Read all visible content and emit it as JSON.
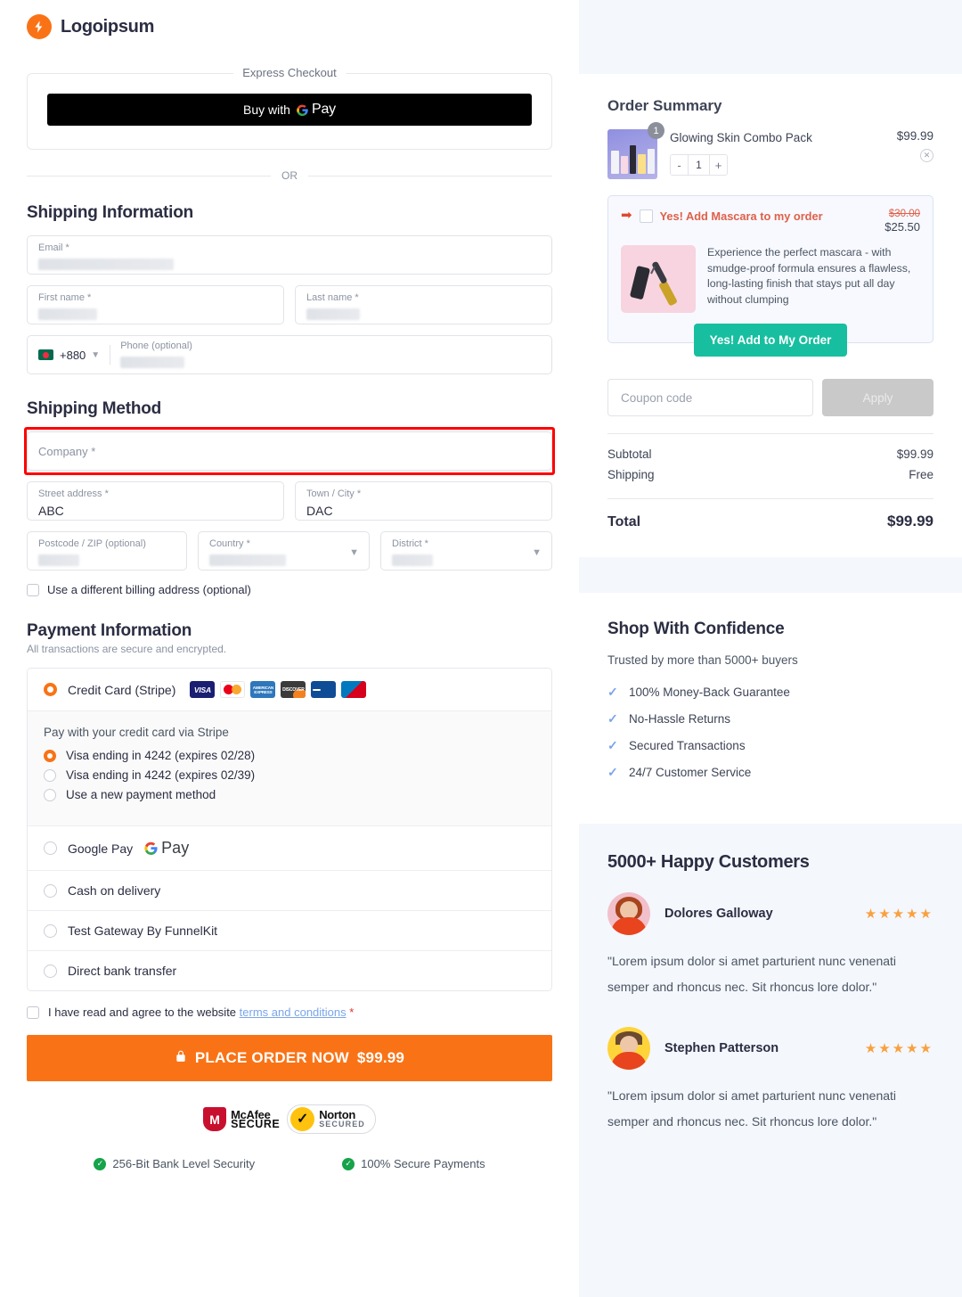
{
  "brand": {
    "name": "Logoipsum",
    "accent": "#F97316"
  },
  "express": {
    "legend": "Express Checkout",
    "gpay_prefix": "Buy with",
    "gpay_g": "G",
    "gpay_word": "Pay",
    "or_label": "OR"
  },
  "shipping_information": {
    "heading": "Shipping Information",
    "email_label": "Email *",
    "email_value": "",
    "first_name_label": "First name *",
    "first_name_value": "",
    "last_name_label": "Last name *",
    "last_name_value": "",
    "phone_country_code": "+880",
    "phone_label": "Phone (optional)",
    "phone_value": ""
  },
  "shipping_method": {
    "heading": "Shipping Method",
    "company_label": "Company *",
    "company_value": "",
    "street_label": "Street address *",
    "street_value": "ABC",
    "city_label": "Town / City *",
    "city_value": "DAC",
    "postcode_label": "Postcode / ZIP (optional)",
    "postcode_value": "",
    "country_label": "Country *",
    "country_value": "",
    "district_label": "District *",
    "district_value": "",
    "billing_checkbox_label": "Use a different billing address (optional)"
  },
  "payment": {
    "heading": "Payment Information",
    "subheading": "All transactions are secure and encrypted.",
    "methods": [
      {
        "label": "Credit Card (Stripe)",
        "selected": true,
        "has_cards": true
      },
      {
        "label": "Google Pay",
        "selected": false,
        "has_gpay": true
      },
      {
        "label": "Cash on delivery",
        "selected": false
      },
      {
        "label": "Test Gateway By FunnelKit",
        "selected": false
      },
      {
        "label": "Direct bank transfer",
        "selected": false
      }
    ],
    "card_brands": [
      "visa-icon",
      "mastercard-icon",
      "amex-icon",
      "discover-icon",
      "jcb-icon",
      "diners-icon"
    ],
    "stripe_panel_title": "Pay with your credit card via Stripe",
    "saved_cards": [
      {
        "label": "Visa ending in 4242 (expires 02/28)",
        "selected": true
      },
      {
        "label": "Visa ending in 4242 (expires 02/39)",
        "selected": false
      },
      {
        "label": "Use a new payment method",
        "selected": false
      }
    ],
    "terms_prefix": "I have read and agree to the website",
    "terms_link": "terms and conditions",
    "terms_required": "*",
    "place_order_label": "PLACE ORDER NOW",
    "place_order_amount": "$99.99"
  },
  "trust": {
    "mcafee_top": "McAfee",
    "mcafee_bottom": "SECURE",
    "norton_top": "Norton",
    "norton_bottom": "SECURED",
    "items": [
      "256-Bit Bank Level Security",
      "100% Secure Payments"
    ]
  },
  "order_summary": {
    "title": "Order Summary",
    "item": {
      "name": "Glowing Skin Combo Pack",
      "price": "$99.99",
      "quantity": "1",
      "badge": "1",
      "minus": "-",
      "plus": "+"
    },
    "upsell": {
      "title": "Yes! Add Mascara to my order",
      "old_price": "$30.00",
      "new_price": "$25.50",
      "description": "Experience the perfect mascara - with smudge-proof formula ensures a flawless, long-lasting finish that stays put all day without clumping",
      "button": "Yes! Add to My Order"
    },
    "coupon_placeholder": "Coupon code",
    "apply_label": "Apply",
    "subtotal_label": "Subtotal",
    "subtotal_value": "$99.99",
    "shipping_label": "Shipping",
    "shipping_value": "Free",
    "total_label": "Total",
    "total_value": "$99.99"
  },
  "confidence": {
    "title": "Shop With Confidence",
    "subtitle": "Trusted by more than 5000+ buyers",
    "items": [
      "100% Money-Back Guarantee",
      "No-Hassle Returns",
      "Secured Transactions",
      "24/7 Customer Service"
    ]
  },
  "testimonials": {
    "title": "5000+ Happy Customers",
    "reviews": [
      {
        "name": "Dolores Galloway",
        "stars": "★★★★★",
        "text": "\"Lorem ipsum dolor si amet parturient nunc venenati semper and rhoncus nec. Sit rhoncus lore dolor.\""
      },
      {
        "name": "Stephen Patterson",
        "stars": "★★★★★",
        "text": "\"Lorem ipsum dolor si amet parturient nunc venenati semper and rhoncus nec. Sit rhoncus lore dolor.\""
      }
    ]
  }
}
